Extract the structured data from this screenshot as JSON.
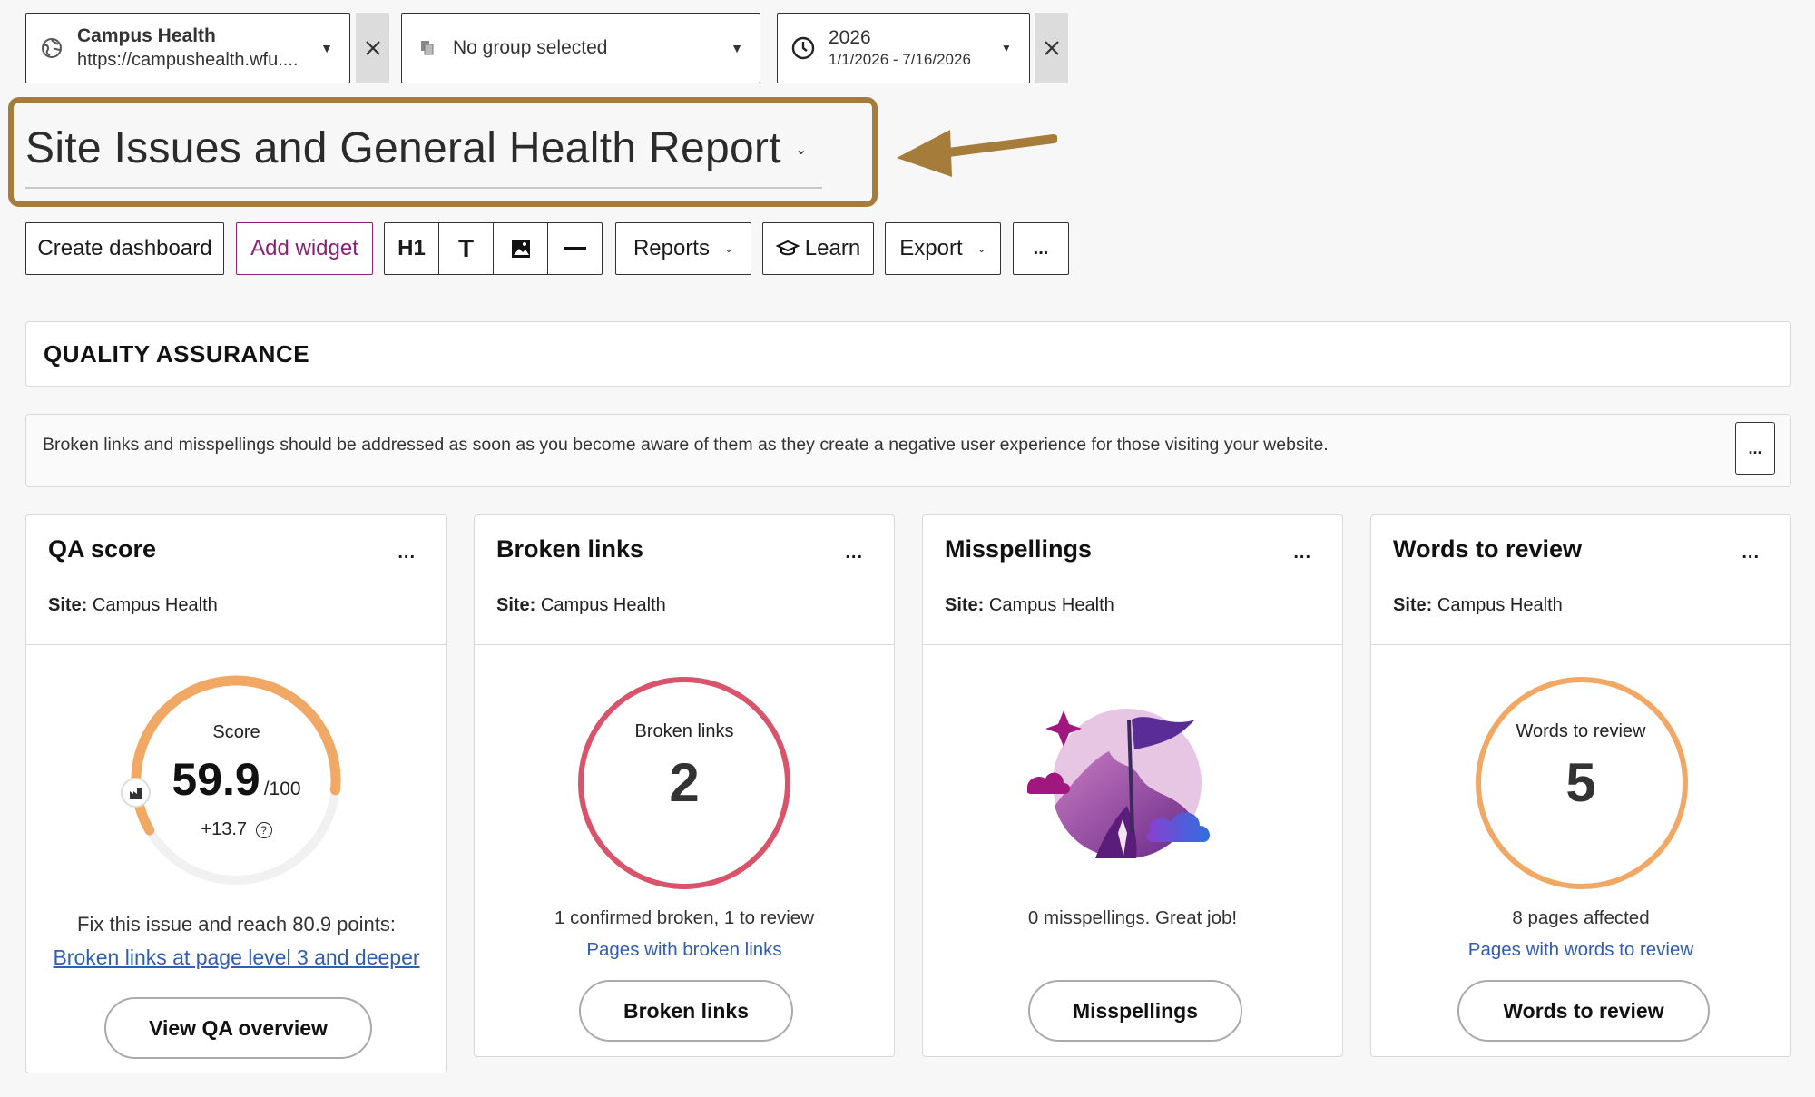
{
  "filters": {
    "site": {
      "name": "Campus Health",
      "url": "https://campushealth.wfu....",
      "icon": "globe-icon"
    },
    "group": {
      "label": "No group selected",
      "icon": "group-icon"
    },
    "date": {
      "year": "2026",
      "range": "1/1/2026 - 7/16/2026",
      "icon": "clock-icon"
    }
  },
  "page": {
    "title": "Site Issues and General Health Report",
    "highlight_color": "#a67c3a"
  },
  "toolbar": {
    "create_dashboard": "Create dashboard",
    "add_widget": "Add widget",
    "h1": "H1",
    "text_tool": "T",
    "reports": "Reports",
    "learn": "Learn",
    "export": "Export",
    "more": "..."
  },
  "section": {
    "title": "QUALITY ASSURANCE",
    "description": "Broken links and misspellings should be addressed as soon as you become aware of them as they create a negative user experience for those visiting your website.",
    "more": "..."
  },
  "cards": [
    {
      "title": "QA score",
      "site_label": "Site:",
      "site_value": "Campus Health",
      "menu": "...",
      "gauge_label": "Score",
      "score": "59.9",
      "score_max": "/100",
      "score_fraction": 0.599,
      "change": "+13.7",
      "fix_text": "Fix this issue and reach 80.9 points:",
      "fix_link": "Broken links at page level 3 and deeper",
      "button": "View QA overview",
      "color": "#f2a865"
    },
    {
      "title": "Broken links",
      "site_label": "Site:",
      "site_value": "Campus Health",
      "menu": "...",
      "gauge_label": "Broken links",
      "value": "2",
      "caption": "1 confirmed broken, 1 to review",
      "link": "Pages with broken links",
      "button": "Broken links",
      "color": "#d9536a"
    },
    {
      "title": "Misspellings",
      "site_label": "Site:",
      "site_value": "Campus Health",
      "menu": "...",
      "caption": "0 misspellings. Great job!",
      "button": "Misspellings"
    },
    {
      "title": "Words to review",
      "site_label": "Site:",
      "site_value": "Campus Health",
      "menu": "...",
      "gauge_label": "Words to review",
      "value": "5",
      "caption": "8 pages affected",
      "link": "Pages with words to review",
      "button": "Words to review",
      "color": "#f2a865"
    }
  ]
}
